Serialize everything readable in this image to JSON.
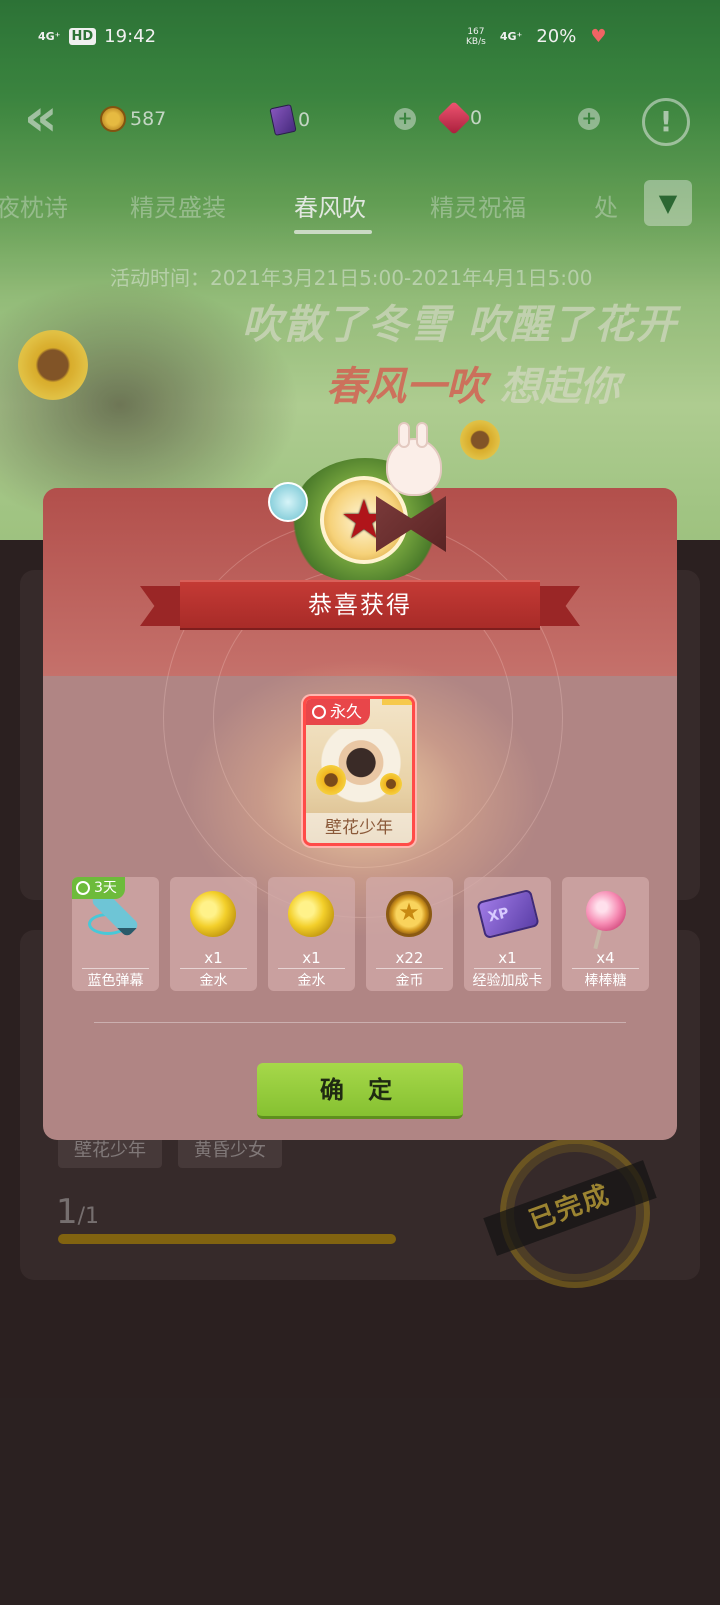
{
  "status_bar": {
    "network_left": "4G⁺",
    "hd": "HD",
    "time": "19:42",
    "speed_value": "167",
    "speed_unit": "KB/s",
    "network_right": "4G⁺",
    "battery": "20%"
  },
  "currency": {
    "coins": "587",
    "cards": "0",
    "gems": "0"
  },
  "tabs": [
    {
      "label": "夜枕诗"
    },
    {
      "label": "精灵盛装"
    },
    {
      "label": "春风吹"
    },
    {
      "label": "精灵祝福"
    },
    {
      "label": "处"
    }
  ],
  "active_tab_index": 2,
  "banner": {
    "event_time": "活动时间：2021年3月21日5:00-2021年4月1日5:00",
    "slogan_line1": "吹散了冬雪 吹醒了花开",
    "slogan_line2_highlight": "春风一吹",
    "slogan_line2_rest": " 想起你"
  },
  "background_task": {
    "tags": [
      "壁花少年",
      "黄昏少女",
      "",
      ""
    ],
    "progress_current": "1",
    "progress_total": "/1",
    "progress_fraction": 1.0,
    "status_stamp": "已完成"
  },
  "modal": {
    "title": "恭喜获得",
    "featured": {
      "tag": "永久",
      "name": "壁花少年"
    },
    "items": [
      {
        "name": "蓝色弹幕",
        "qty": "",
        "timer": "3天",
        "icon": "dart-icon"
      },
      {
        "name": "金水",
        "qty": "x1",
        "icon": "gold-water-icon"
      },
      {
        "name": "金水",
        "qty": "x1",
        "icon": "gold-water-icon"
      },
      {
        "name": "金币",
        "qty": "x22",
        "icon": "coin-icon"
      },
      {
        "name": "经验加成卡",
        "qty": "x1",
        "icon": "xp-card-icon"
      },
      {
        "name": "棒棒糖",
        "qty": "x4",
        "icon": "lollipop-icon"
      }
    ],
    "confirm_label": "确 定"
  },
  "colors": {
    "modal_body": "#b08584",
    "modal_header": "#b24f4b",
    "ribbon": "#c43a35",
    "confirm_button": "#a6d84a",
    "timer_badge": "#6dbb3b",
    "featured_border": "#ff4b48"
  }
}
